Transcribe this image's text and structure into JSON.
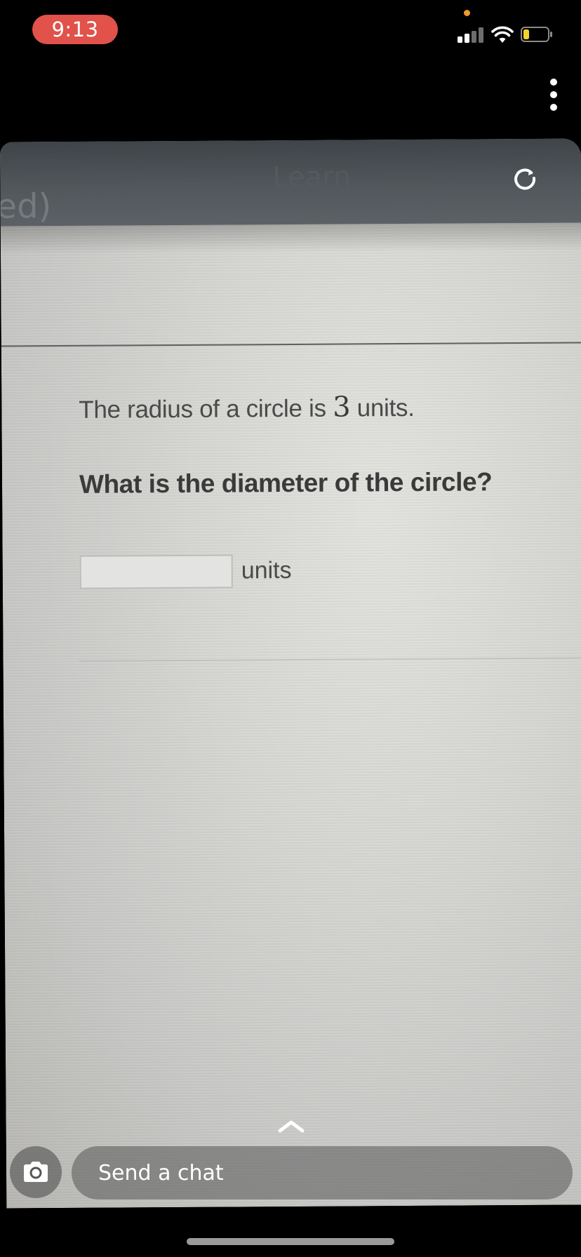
{
  "status_bar": {
    "time": "9:13",
    "time_pill_color": "#e0524a",
    "mic_indicator_color": "#f19a30",
    "signal_bars_active": 2,
    "signal_bars_total": 4,
    "battery_level": 0.2,
    "battery_color": "#f5d327",
    "icons": [
      "signal-icon",
      "wifi-icon",
      "battery-icon"
    ]
  },
  "top_controls": {
    "more_menu_icon": "vertical-ellipsis-icon",
    "refresh_icon": "refresh-icon"
  },
  "photo": {
    "header_left_fragment": "ed)",
    "header_title": "Learn",
    "problem": {
      "statement_prefix": "The radius of a circle is ",
      "radius_value": "3",
      "statement_suffix": " units.",
      "question": "What is the diameter of the circle?",
      "answer_value": "",
      "answer_unit": "units"
    }
  },
  "chat_bar": {
    "camera_icon": "camera-icon",
    "placeholder": "Send a chat",
    "expand_icon": "chevron-up-icon"
  }
}
